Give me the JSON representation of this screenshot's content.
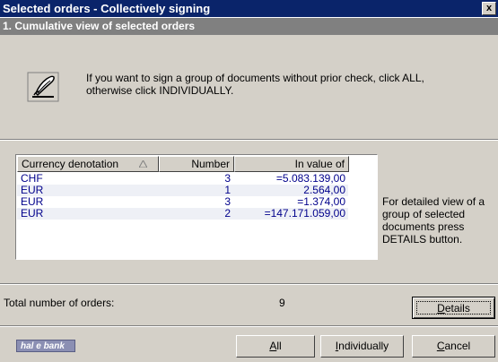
{
  "window": {
    "title": "Selected orders - Collectively signing",
    "close_glyph": "x"
  },
  "step": {
    "title": "1. Cumulative view of selected orders"
  },
  "info": {
    "icon": "pen-signing-icon",
    "line1": "If you want to sign a group of documents without prior check, click ALL,",
    "line2": "otherwise click INDIVIDUALLY."
  },
  "table": {
    "columns": [
      "Currency denotation",
      "Number",
      "In value of"
    ],
    "rows": [
      [
        "CHF",
        "3",
        "=5.083.139,00"
      ],
      [
        "EUR",
        "1",
        "2.564,00"
      ],
      [
        "EUR",
        "3",
        "=1.374,00"
      ],
      [
        "EUR",
        "2",
        "=147.171.059,00"
      ]
    ]
  },
  "side_note": {
    "line1": "For detailed view of a",
    "line2": "group of selected",
    "line3": "documents press",
    "line4": "DETAILS button."
  },
  "totals": {
    "label": "Total number of  orders:",
    "value": "9"
  },
  "buttons": {
    "details_pre": "",
    "details_key": "D",
    "details_post": "etails",
    "all_key": "A",
    "all_post": "ll",
    "individually_key": "I",
    "individually_post": "ndividually",
    "cancel_key": "C",
    "cancel_post": "ancel"
  },
  "logo": {
    "text": "hal e bank"
  },
  "colors": {
    "title_bg": "#0a246a",
    "subtitle_bg": "#808080",
    "row_text": "#00008b",
    "dialog_bg": "#d4d0c8"
  }
}
